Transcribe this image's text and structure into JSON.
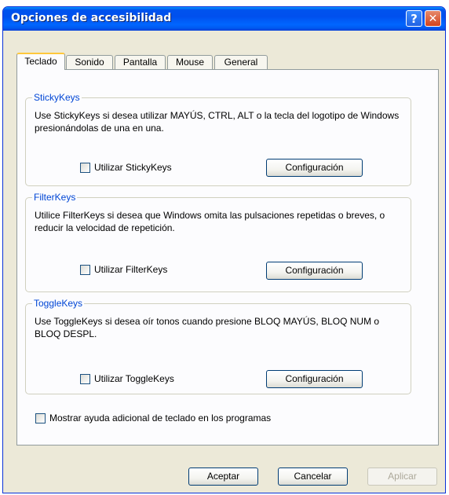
{
  "window": {
    "title": "Opciones de accesibilidad",
    "help_glyph": "?",
    "close_glyph": "✕"
  },
  "tabs": [
    {
      "label": "Teclado",
      "active": true
    },
    {
      "label": "Sonido",
      "active": false
    },
    {
      "label": "Pantalla",
      "active": false
    },
    {
      "label": "Mouse",
      "active": false
    },
    {
      "label": "General",
      "active": false
    }
  ],
  "groups": {
    "stickykeys": {
      "title": "StickyKeys",
      "description": "Use StickyKeys si desea utilizar MAYÚS, CTRL, ALT o la tecla del logotipo de Windows presionándolas de una en una.",
      "checkbox_label": "Utilizar StickyKeys",
      "checked": false,
      "button_label": "Configuración"
    },
    "filterkeys": {
      "title": "FilterKeys",
      "description": "Utilice FilterKeys si desea que Windows omita las pulsaciones repetidas o breves, o reducir la velocidad de repetición.",
      "checkbox_label": "Utilizar FilterKeys",
      "checked": false,
      "button_label": "Configuración"
    },
    "togglekeys": {
      "title": "ToggleKeys",
      "description": "Use ToggleKeys si desea oír tonos cuando presione BLOQ MAYÚS, BLOQ NUM o BLOQ DESPL.",
      "checkbox_label": "Utilizar ToggleKeys",
      "checked": false,
      "button_label": "Configuración"
    }
  },
  "extra_help": {
    "label": "Mostrar ayuda adicional de teclado en los programas",
    "checked": false
  },
  "footer": {
    "ok_label": "Aceptar",
    "cancel_label": "Cancelar",
    "apply_label": "Aplicar",
    "apply_enabled": false
  },
  "colors": {
    "titlebar": "#0054e3",
    "group_title": "#0046d5",
    "dialog_bg": "#ece9d8",
    "tab_highlight": "#ffc83c"
  }
}
